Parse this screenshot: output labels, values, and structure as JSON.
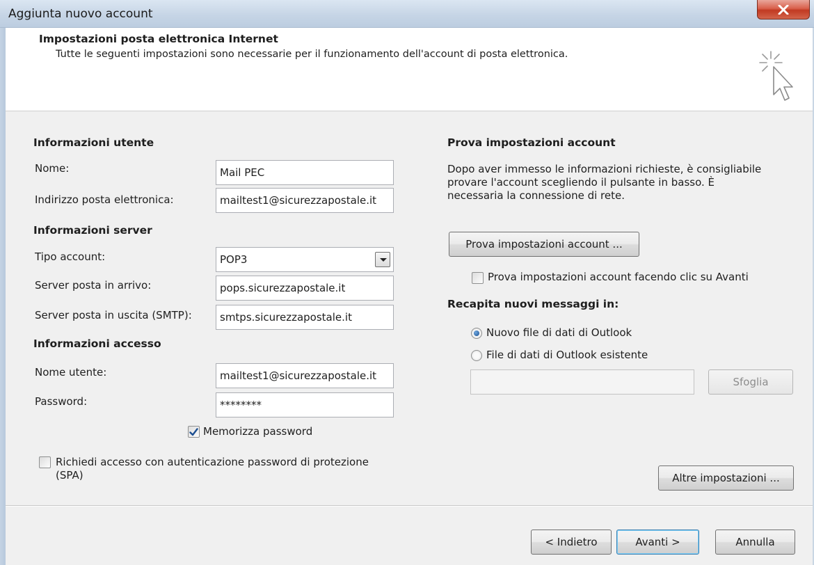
{
  "window": {
    "title": "Aggiunta nuovo account",
    "close_icon": "close-icon"
  },
  "header": {
    "title": "Impostazioni posta elettronica Internet",
    "subtitle": "Tutte le seguenti impostazioni sono necessarie per il funzionamento dell'account di posta elettronica.",
    "icon": "cursor-sparkle-icon"
  },
  "user_info": {
    "section_title": "Informazioni utente",
    "name_label": "Nome:",
    "name_value": "Mail PEC",
    "email_label": "Indirizzo posta elettronica:",
    "email_value": "mailtest1@sicurezzapostale.it"
  },
  "server_info": {
    "section_title": "Informazioni server",
    "account_type_label": "Tipo account:",
    "account_type_value": "POP3",
    "incoming_label": "Server posta in arrivo:",
    "incoming_value": "pops.sicurezzapostale.it",
    "outgoing_label": "Server posta in uscita (SMTP):",
    "outgoing_value": "smtps.sicurezzapostale.it"
  },
  "access_info": {
    "section_title": "Informazioni accesso",
    "username_label": "Nome utente:",
    "username_value": "mailtest1@sicurezzapostale.it",
    "password_label": "Password:",
    "password_value": "********",
    "remember_password_label": "Memorizza password",
    "remember_password_checked": true,
    "spa_label_line1": "Richiedi accesso con autenticazione password di protezione",
    "spa_label_line2": "(SPA)",
    "spa_checked": false
  },
  "test_settings": {
    "section_title": "Prova impostazioni account",
    "description_line1": "Dopo aver immesso le informazioni richieste, è consigliabile",
    "description_line2": "provare l'account scegliendo il pulsante in basso. È",
    "description_line3": "necessaria la connessione di rete.",
    "test_button_label": "Prova impostazioni account ...",
    "auto_test_label": "Prova impostazioni account facendo clic su Avanti",
    "auto_test_checked": false
  },
  "deliver": {
    "section_title": "Recapita nuovi messaggi in:",
    "option_new_label": "Nuovo file di dati di Outlook",
    "option_new_selected": true,
    "option_existing_label": "File di dati di Outlook esistente",
    "option_existing_selected": false,
    "existing_path_value": "",
    "browse_label": "Sfoglia"
  },
  "more_settings_label": "Altre impostazioni ...",
  "footer": {
    "back_label": "< Indietro",
    "next_label": "Avanti >",
    "cancel_label": "Annulla"
  }
}
